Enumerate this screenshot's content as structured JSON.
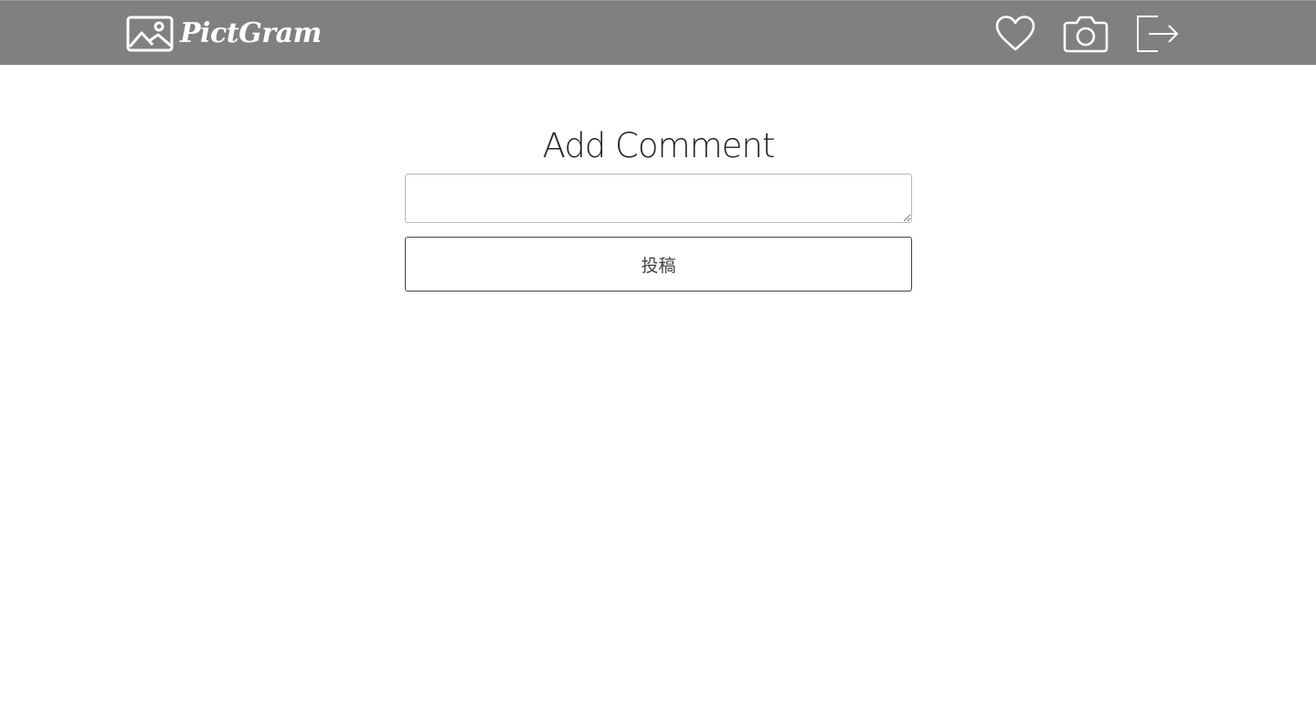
{
  "header": {
    "brand_name": "PictGram",
    "icons": [
      "picture-icon",
      "heart-icon",
      "camera-icon",
      "logout-icon"
    ]
  },
  "main": {
    "title": "Add Comment",
    "comment_value": "",
    "submit_label": "投稿"
  },
  "colors": {
    "header_bg": "#808080",
    "header_fg": "#ffffff",
    "text": "#222222",
    "button_border": "#444444"
  }
}
